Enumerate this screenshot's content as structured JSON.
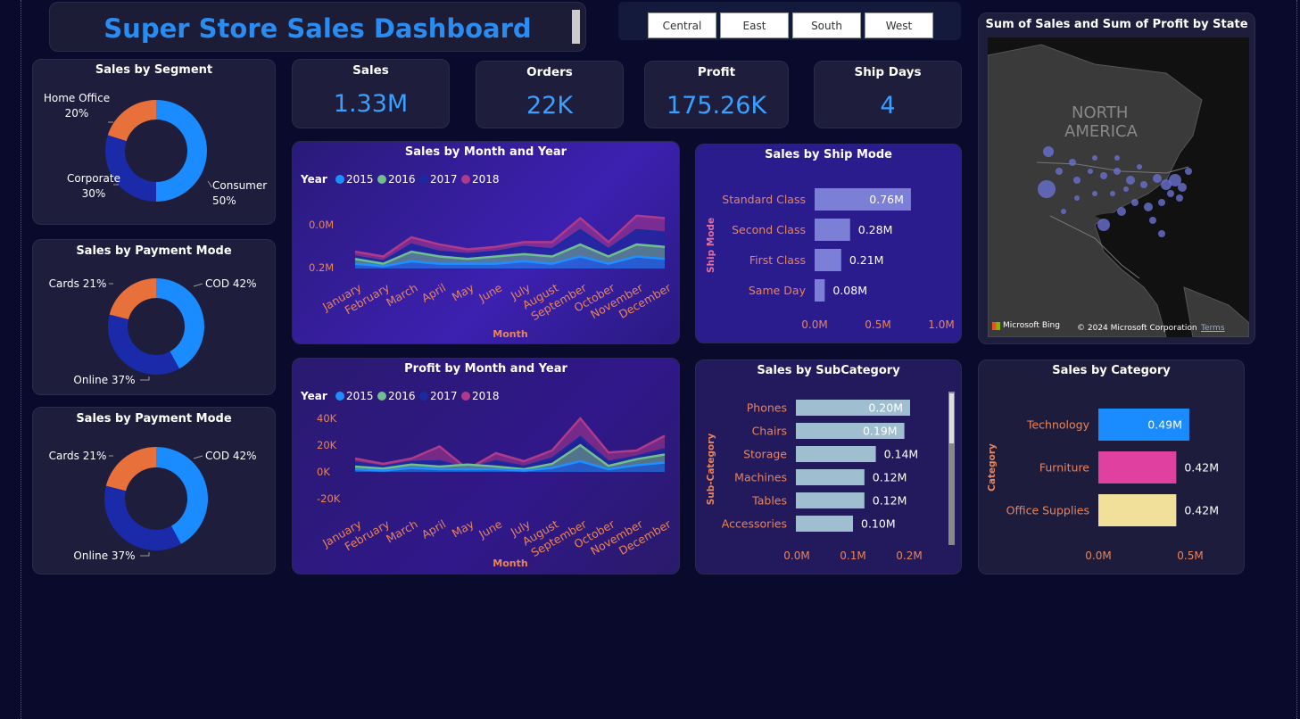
{
  "title": "Super Store Sales Dashboard",
  "filters": [
    "Central",
    "East",
    "South",
    "West"
  ],
  "kpis": {
    "sales": {
      "label": "Sales",
      "value": "1.33M"
    },
    "orders": {
      "label": "Orders",
      "value": "22K"
    },
    "profit": {
      "label": "Profit",
      "value": "175.26K"
    },
    "ship_days": {
      "label": "Ship Days",
      "value": "4"
    }
  },
  "map": {
    "title": "Sum of Sales and Sum of Profit by State",
    "label_line1": "NORTH",
    "label_line2": "AMERICA",
    "bing": "Microsoft Bing",
    "copyright": "© 2024 Microsoft Corporation",
    "terms": "Terms"
  },
  "colors": {
    "y2015": "#1f8fff",
    "y2016": "#6fbf8f",
    "y2017": "#1c2aa0",
    "y2018": "#b03a8a",
    "donut_blue": "#1a8cff",
    "donut_navy": "#1a2aa8",
    "donut_orange": "#e8703a",
    "tech": "#1a8cff",
    "furniture": "#e040a0",
    "office": "#f0e09a"
  },
  "chart_data": [
    {
      "id": "segment",
      "type": "pie",
      "title": "Sales by Segment",
      "slices": [
        {
          "label": "Consumer",
          "value": 50,
          "pct": "50%"
        },
        {
          "label": "Corporate",
          "value": 30,
          "pct": "30%"
        },
        {
          "label": "Home Office",
          "value": 20,
          "pct": "20%"
        }
      ]
    },
    {
      "id": "payment1",
      "type": "pie",
      "title": "Sales by Payment Mode",
      "slices": [
        {
          "label": "COD",
          "value": 42,
          "pct": "42%"
        },
        {
          "label": "Online",
          "value": 37,
          "pct": "37%"
        },
        {
          "label": "Cards",
          "value": 21,
          "pct": "21%"
        }
      ]
    },
    {
      "id": "payment2",
      "type": "pie",
      "title": "Sales by Payment Mode",
      "slices": [
        {
          "label": "COD",
          "value": 42,
          "pct": "42%"
        },
        {
          "label": "Online",
          "value": 37,
          "pct": "37%"
        },
        {
          "label": "Cards",
          "value": 21,
          "pct": "21%"
        }
      ]
    },
    {
      "id": "sales_month",
      "type": "area",
      "title": "Sales by Month and Year",
      "legend_title": "Year",
      "xlabel": "Month",
      "categories": [
        "January",
        "February",
        "March",
        "April",
        "May",
        "June",
        "July",
        "August",
        "September",
        "October",
        "November",
        "December"
      ],
      "y_ticks": [
        "0.0M",
        "0.2M"
      ],
      "ylim": [
        0,
        0.26
      ],
      "series": [
        {
          "name": "2015",
          "values": [
            0.02,
            0.01,
            0.03,
            0.02,
            0.02,
            0.02,
            0.03,
            0.02,
            0.05,
            0.02,
            0.05,
            0.04
          ]
        },
        {
          "name": "2016",
          "values": [
            0.02,
            0.01,
            0.04,
            0.03,
            0.02,
            0.03,
            0.03,
            0.03,
            0.05,
            0.03,
            0.05,
            0.05
          ]
        },
        {
          "name": "2017",
          "values": [
            0.01,
            0.01,
            0.03,
            0.02,
            0.02,
            0.02,
            0.03,
            0.03,
            0.06,
            0.03,
            0.06,
            0.06
          ]
        },
        {
          "name": "2018",
          "values": [
            0.02,
            0.02,
            0.03,
            0.03,
            0.02,
            0.02,
            0.02,
            0.03,
            0.05,
            0.03,
            0.06,
            0.06
          ]
        }
      ]
    },
    {
      "id": "profit_month",
      "type": "area",
      "title": "Profit by Month and Year",
      "legend_title": "Year",
      "xlabel": "Month",
      "categories": [
        "January",
        "February",
        "March",
        "April",
        "May",
        "June",
        "July",
        "August",
        "September",
        "October",
        "November",
        "December"
      ],
      "y_ticks": [
        "40K",
        "20K",
        "0K",
        "-20K"
      ],
      "ylim": [
        -20000,
        40000
      ],
      "series": [
        {
          "name": "2015",
          "values": [
            2000,
            1000,
            3000,
            2000,
            2000,
            2000,
            1000,
            3000,
            8000,
            2000,
            5000,
            7000
          ]
        },
        {
          "name": "2016",
          "values": [
            2000,
            1500,
            2500,
            2000,
            3500,
            2000,
            1000,
            3000,
            12000,
            2500,
            4500,
            6000
          ]
        },
        {
          "name": "2017",
          "values": [
            3000,
            1500,
            2000,
            4000,
            -3000,
            4000,
            2000,
            4000,
            6000,
            3000,
            2000,
            4000
          ]
        },
        {
          "name": "2018",
          "values": [
            3000,
            2000,
            2500,
            11000,
            -500,
            6000,
            4000,
            6000,
            14000,
            7000,
            4500,
            10000
          ]
        }
      ]
    },
    {
      "id": "ship_mode",
      "type": "bar",
      "title": "Sales by Ship Mode",
      "ylabel": "Ship Mode",
      "categories": [
        "Standard Class",
        "Second Class",
        "First Class",
        "Same Day"
      ],
      "values": [
        0.76,
        0.28,
        0.21,
        0.08
      ],
      "labels": [
        "0.76M",
        "0.28M",
        "0.21M",
        "0.08M"
      ],
      "x_ticks": [
        "0.0M",
        "0.5M",
        "1.0M"
      ],
      "xlim": [
        0,
        1.0
      ]
    },
    {
      "id": "subcategory",
      "type": "bar",
      "title": "Sales by SubCategory",
      "ylabel": "Sub-Category",
      "categories": [
        "Phones",
        "Chairs",
        "Storage",
        "Machines",
        "Tables",
        "Accessories"
      ],
      "values": [
        0.2,
        0.19,
        0.14,
        0.12,
        0.12,
        0.1
      ],
      "labels": [
        "0.20M",
        "0.19M",
        "0.14M",
        "0.12M",
        "0.12M",
        "0.10M"
      ],
      "x_ticks": [
        "0.0M",
        "0.1M",
        "0.2M"
      ],
      "xlim": [
        0,
        0.2
      ]
    },
    {
      "id": "category",
      "type": "bar",
      "title": "Sales by Category",
      "ylabel": "Category",
      "categories": [
        "Technology",
        "Furniture",
        "Office Supplies"
      ],
      "values": [
        0.49,
        0.42,
        0.42
      ],
      "labels": [
        "0.49M",
        "0.42M",
        "0.42M"
      ],
      "x_ticks": [
        "0.0M",
        "0.5M"
      ],
      "xlim": [
        0,
        0.5
      ]
    }
  ]
}
